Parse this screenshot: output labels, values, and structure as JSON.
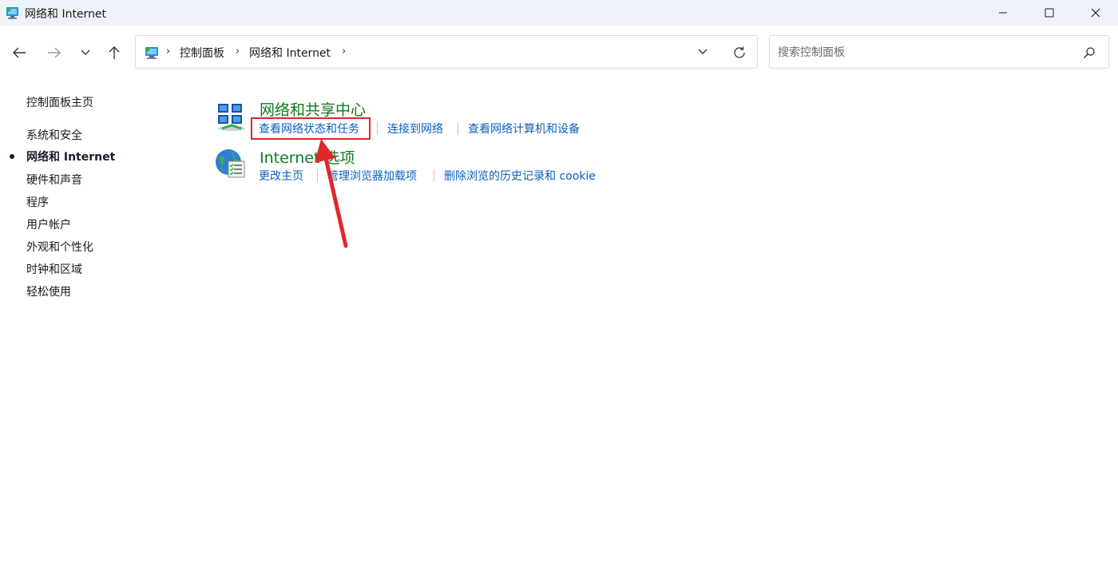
{
  "window": {
    "title": "网络和 Internet",
    "app_icon": "control-panel-icon",
    "controls": [
      "minimize-icon",
      "maximize-icon",
      "close-icon"
    ]
  },
  "nav": {
    "back": "back-arrow-icon",
    "forward": "forward-arrow-icon",
    "recent": "chevron-down-icon",
    "up": "up-arrow-icon"
  },
  "address": {
    "crumbs": [
      "控制面板",
      "网络和 Internet"
    ]
  },
  "search": {
    "placeholder": "搜索控制面板"
  },
  "sidebar": {
    "home": "控制面板主页",
    "items": [
      {
        "label": "系统和安全",
        "active": false
      },
      {
        "label": "网络和 Internet",
        "active": true
      },
      {
        "label": "硬件和声音",
        "active": false
      },
      {
        "label": "程序",
        "active": false
      },
      {
        "label": "用户帐户",
        "active": false
      },
      {
        "label": "外观和个性化",
        "active": false
      },
      {
        "label": "时钟和区域",
        "active": false
      },
      {
        "label": "轻松使用",
        "active": false
      }
    ]
  },
  "categories": [
    {
      "title": "网络和共享中心",
      "icon": "network-sharing-icon",
      "links": [
        "查看网络状态和任务",
        "连接到网络",
        "查看网络计算机和设备"
      ]
    },
    {
      "title": "Internet 选项",
      "icon": "internet-options-icon",
      "links": [
        "更改主页",
        "管理浏览器加载项",
        "删除浏览的历史记录和 cookie"
      ]
    }
  ],
  "colors": {
    "category_title": "#0d7a1f",
    "link": "#0a5fbf",
    "annotation": "#e0262c"
  }
}
